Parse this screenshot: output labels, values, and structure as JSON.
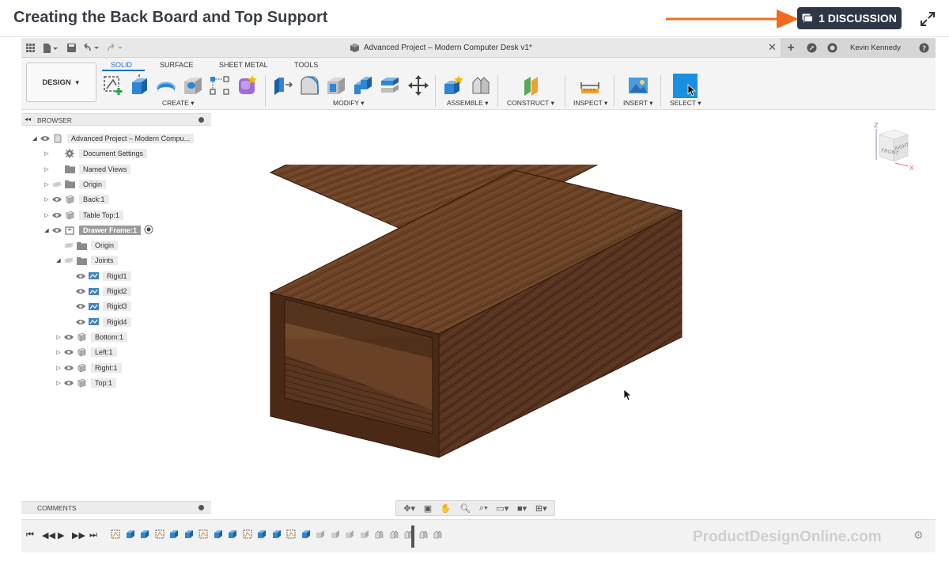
{
  "lesson": {
    "title": "Creating the Back Board and Top Support",
    "discussion_label": "1 DISCUSSION"
  },
  "titlebar": {
    "document_title": "Advanced Project – Modern Computer Desk v1*",
    "user": "Kevin Kennedy"
  },
  "ribbon": {
    "workspace_label": "DESIGN",
    "tabs": [
      "SOLID",
      "SURFACE",
      "SHEET METAL",
      "TOOLS"
    ],
    "active_tab": "SOLID",
    "groups": [
      "CREATE",
      "MODIFY",
      "ASSEMBLE",
      "CONSTRUCT",
      "INSPECT",
      "INSERT",
      "SELECT"
    ]
  },
  "browser": {
    "header": "BROWSER",
    "items": [
      {
        "label": "Advanced Project – Modern Compu..."
      },
      {
        "label": "Document Settings"
      },
      {
        "label": "Named Views"
      },
      {
        "label": "Origin"
      },
      {
        "label": "Back:1"
      },
      {
        "label": "Table Top:1"
      },
      {
        "label": "Drawer Frame:1"
      },
      {
        "label": "Origin"
      },
      {
        "label": "Joints"
      },
      {
        "label": "Rigid1"
      },
      {
        "label": "Rigid2"
      },
      {
        "label": "Rigid3"
      },
      {
        "label": "Rigid4"
      },
      {
        "label": "Bottom:1"
      },
      {
        "label": "Left:1"
      },
      {
        "label": "Right:1"
      },
      {
        "label": "Top:1"
      }
    ]
  },
  "comments": {
    "label": "COMMENTS"
  },
  "viewcube": {
    "front": "FRONT",
    "right": "RIGHT",
    "z": "Z",
    "x": "X"
  },
  "watermark": "ProductDesignOnline.com",
  "colors": {
    "accent_blue": "#1d6fc0",
    "annotation_orange": "#f26b1d",
    "discussion_bg": "#2f3747",
    "wood_dark": "#4a2a16",
    "wood_mid": "#6b4225"
  }
}
